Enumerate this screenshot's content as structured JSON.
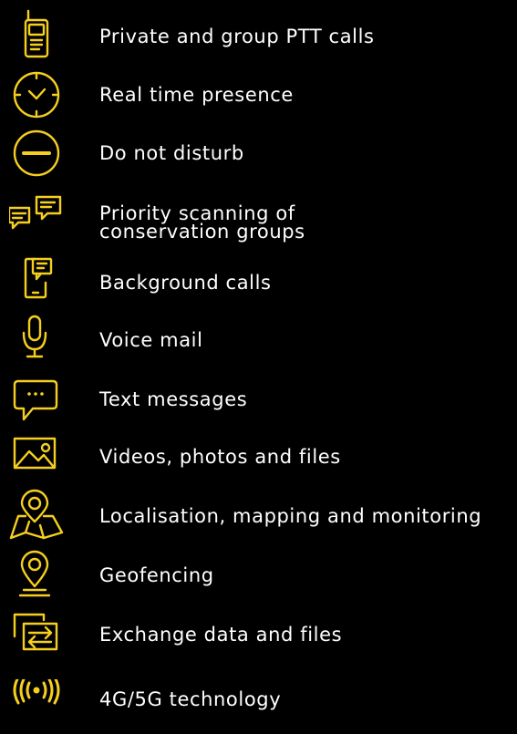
{
  "colors": {
    "background": "#000000",
    "icon": "#f6cf1e",
    "text": "#ffffff"
  },
  "features": [
    {
      "icon": "walkie-talkie-icon",
      "label": "Private and group PTT calls"
    },
    {
      "icon": "clock-icon",
      "label": "Real time presence"
    },
    {
      "icon": "do-not-disturb-icon",
      "label": "Do not disturb"
    },
    {
      "icon": "chat-bubbles-icon",
      "label": "Priority scanning of\nconservation groups"
    },
    {
      "icon": "phone-message-icon",
      "label": "Background calls"
    },
    {
      "icon": "microphone-icon",
      "label": "Voice mail"
    },
    {
      "icon": "speech-bubble-icon",
      "label": "Text messages"
    },
    {
      "icon": "image-icon",
      "label": "Videos, photos and files"
    },
    {
      "icon": "map-pin-icon",
      "label": "Localisation, mapping and monitoring"
    },
    {
      "icon": "geofence-pin-icon",
      "label": "Geofencing"
    },
    {
      "icon": "exchange-icon",
      "label": "Exchange data and files"
    },
    {
      "icon": "signal-broadcast-icon",
      "label": "4G/5G technology"
    }
  ]
}
